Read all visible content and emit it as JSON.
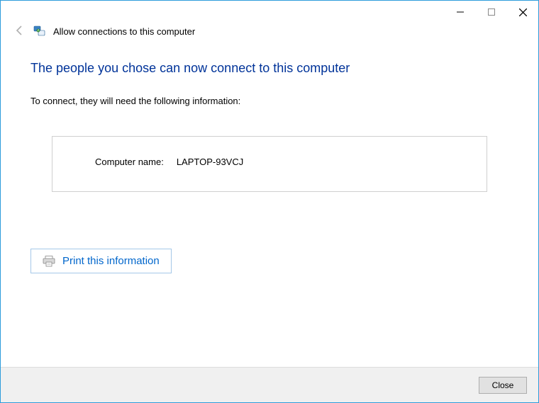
{
  "header": {
    "title": "Allow connections to this computer"
  },
  "main": {
    "heading": "The people you chose can now connect to this computer",
    "instruction": "To connect, they will need the following information:",
    "computer_name_label": "Computer name:",
    "computer_name_value": "LAPTOP-93VCJ",
    "print_link": "Print this information"
  },
  "footer": {
    "close_label": "Close"
  }
}
